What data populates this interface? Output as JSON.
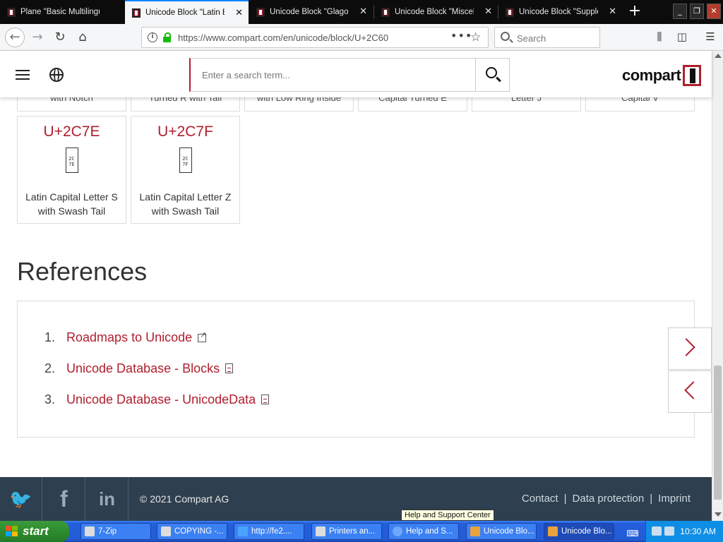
{
  "browser": {
    "tabs": [
      {
        "label": "Plane \"Basic Multilingual",
        "active": false
      },
      {
        "label": "Unicode Block \"Latin Ext",
        "active": true
      },
      {
        "label": "Unicode Block \"Glagolitic\"",
        "active": false
      },
      {
        "label": "Unicode Block \"Miscellan",
        "active": false
      },
      {
        "label": "Unicode Block \"Suppleme",
        "active": false
      }
    ],
    "url_host": "https://www.compart.com",
    "url_path": "/en/unicode/block/U+2C60",
    "search_placeholder": "Search"
  },
  "site": {
    "search_placeholder": "Enter a search term...",
    "logo_text": "compart"
  },
  "partial_cells": [
    "with Notch",
    "Turned R with Tail",
    "with Low Ring Inside",
    "Capital Turned E",
    "Letter J",
    "Capital V"
  ],
  "cells": [
    {
      "code": "U+2C7E",
      "glyph": "2C 7E",
      "name_line1": "Latin Capital Letter S",
      "name_line2": "with Swash Tail"
    },
    {
      "code": "U+2C7F",
      "glyph": "2C 7F",
      "name_line1": "Latin Capital Letter Z",
      "name_line2": "with Swash Tail"
    }
  ],
  "references": {
    "heading": "References",
    "items": [
      {
        "num": "1.",
        "label": "Roadmaps to Unicode",
        "icon": "external-link-icon"
      },
      {
        "num": "2.",
        "label": "Unicode Database - Blocks",
        "icon": "document-icon"
      },
      {
        "num": "3.",
        "label": "Unicode Database - UnicodeData",
        "icon": "document-icon"
      }
    ]
  },
  "footer": {
    "copyright": "© 2021 Compart AG",
    "links": [
      "Contact",
      "Data protection",
      "Imprint"
    ],
    "social": [
      "twitter-icon",
      "facebook-icon",
      "linkedin-icon"
    ]
  },
  "tooltip": "Help and Support Center",
  "taskbar": {
    "start_label": "start",
    "tasks": [
      {
        "label": "7-Zip",
        "active": false
      },
      {
        "label": "COPYING -...",
        "active": false
      },
      {
        "label": "http://fe2....",
        "active": false
      },
      {
        "label": "Printers an...",
        "active": false
      },
      {
        "label": "Help and S...",
        "active": false
      },
      {
        "label": "Unicode Blo...",
        "active": false
      },
      {
        "label": "Unicode Blo...",
        "active": true
      }
    ],
    "clock": "10:30 AM"
  },
  "colors": {
    "accent": "#b01e2d",
    "footer_bg": "#2e3f4f"
  }
}
